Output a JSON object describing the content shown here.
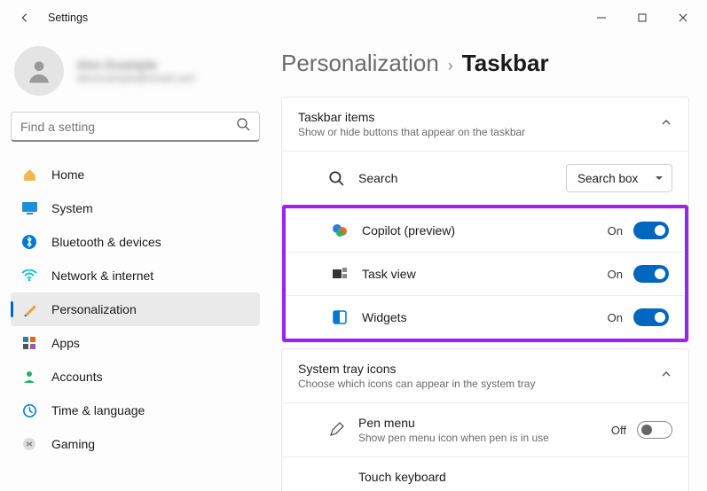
{
  "window": {
    "title": "Settings"
  },
  "profile": {
    "name": "Alex Example",
    "email": "alexexample@email.com"
  },
  "search": {
    "placeholder": "Find a setting"
  },
  "nav": {
    "items": [
      {
        "label": "Home"
      },
      {
        "label": "System"
      },
      {
        "label": "Bluetooth & devices"
      },
      {
        "label": "Network & internet"
      },
      {
        "label": "Personalization"
      },
      {
        "label": "Apps"
      },
      {
        "label": "Accounts"
      },
      {
        "label": "Time & language"
      },
      {
        "label": "Gaming"
      }
    ],
    "active_index": 4
  },
  "breadcrumb": {
    "parent": "Personalization",
    "current": "Taskbar"
  },
  "sections": {
    "taskbar_items": {
      "title": "Taskbar items",
      "subtitle": "Show or hide buttons that appear on the taskbar",
      "rows": {
        "search": {
          "label": "Search",
          "dropdown_value": "Search box"
        },
        "copilot": {
          "label": "Copilot (preview)",
          "state": "On",
          "on": true
        },
        "taskview": {
          "label": "Task view",
          "state": "On",
          "on": true
        },
        "widgets": {
          "label": "Widgets",
          "state": "On",
          "on": true
        }
      }
    },
    "system_tray": {
      "title": "System tray icons",
      "subtitle": "Choose which icons can appear in the system tray",
      "rows": {
        "pen": {
          "label": "Pen menu",
          "sub": "Show pen menu icon when pen is in use",
          "state": "Off",
          "on": false
        },
        "touchkb": {
          "label": "Touch keyboard"
        }
      }
    }
  }
}
